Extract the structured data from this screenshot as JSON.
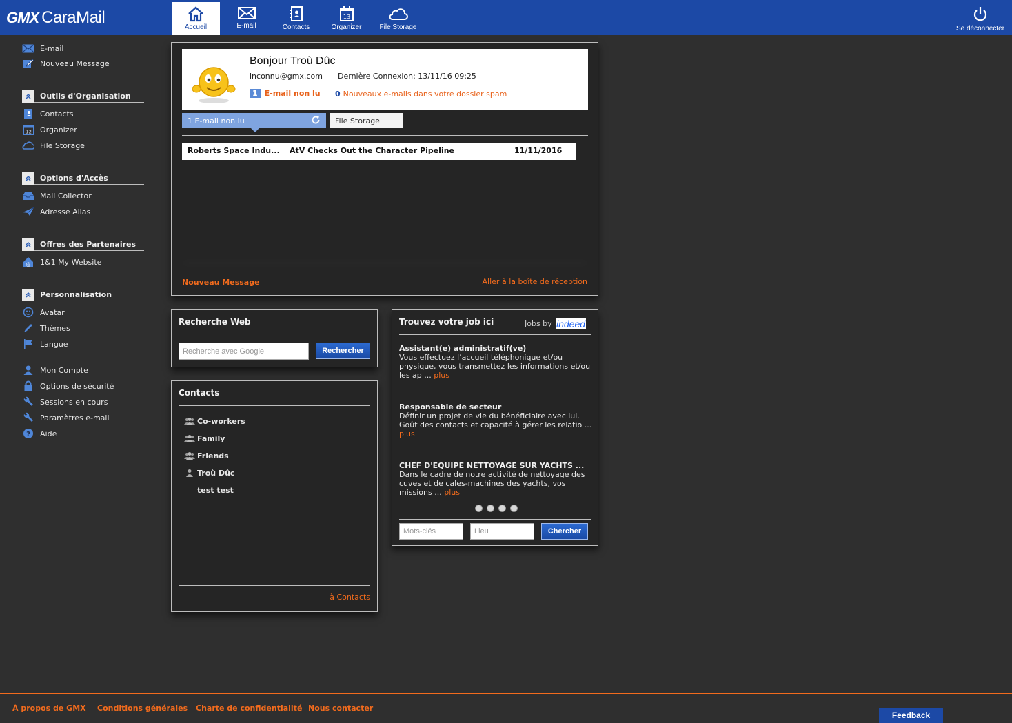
{
  "header": {
    "logo_brand": "GMX",
    "logo_product": "CaraMail",
    "nav": [
      {
        "label": "Accueil",
        "icon": "home-icon",
        "active": true
      },
      {
        "label": "E-mail",
        "icon": "envelope-icon"
      },
      {
        "label": "Contacts",
        "icon": "contacts-book-icon"
      },
      {
        "label": "Organizer",
        "icon": "calendar-icon",
        "day": "13"
      },
      {
        "label": "File Storage",
        "icon": "cloud-icon"
      }
    ],
    "logout_label": "Se déconnecter"
  },
  "sidebar": {
    "top_links": [
      {
        "label": "E-mail",
        "icon": "envelope-icon"
      },
      {
        "label": "Nouveau Message",
        "icon": "pencil-note-icon"
      }
    ],
    "sections": [
      {
        "title": "Outils d'Organisation",
        "items": [
          {
            "label": "Contacts",
            "icon": "contacts-icon"
          },
          {
            "label": "Organizer",
            "icon": "calendar-icon",
            "day": "12"
          },
          {
            "label": "File Storage",
            "icon": "cloud-icon"
          }
        ]
      },
      {
        "title": "Options d'Accès",
        "items": [
          {
            "label": "Mail Collector",
            "icon": "inbox-tray-icon"
          },
          {
            "label": "Adresse Alias",
            "icon": "paper-plane-icon"
          }
        ]
      },
      {
        "title": "Offres des Partenaires",
        "items": [
          {
            "label": "1&1 My Website",
            "icon": "website-house-icon"
          }
        ]
      },
      {
        "title": "Personnalisation",
        "items": [
          {
            "label": "Avatar",
            "icon": "smiley-icon"
          },
          {
            "label": "Thèmes",
            "icon": "brush-icon"
          },
          {
            "label": "Langue",
            "icon": "flag-icon"
          }
        ]
      }
    ],
    "bottom_links": [
      {
        "label": "Mon Compte",
        "icon": "user-icon"
      },
      {
        "label": "Options de sécurité",
        "icon": "lock-icon"
      },
      {
        "label": "Sessions en cours",
        "icon": "wrench-icon"
      },
      {
        "label": "Paramètres e-mail",
        "icon": "wrench-icon"
      },
      {
        "label": "Aide",
        "icon": "help-icon"
      }
    ]
  },
  "welcome": {
    "greeting": "Bonjour Troù Dûc",
    "email": "inconnu@gmx.com",
    "last_login": "Dernière Connexion: 13/11/16 09:25",
    "unread_count": "1",
    "unread_label": "E-mail non lu",
    "spam_count": "0",
    "spam_label": "Nouveaux e-mails dans votre dossier spam",
    "tab_unread": "1 E-mail non lu",
    "tab_storage": "File Storage",
    "messages": [
      {
        "sender": "Roberts Space Indu...",
        "subject": "AtV Checks Out the Character Pipeline",
        "date": "11/11/2016"
      }
    ],
    "new_message_link": "Nouveau Message",
    "inbox_link": "Aller à la boîte de réception"
  },
  "web_search": {
    "title": "Recherche Web",
    "placeholder": "Recherche avec Google",
    "button": "Rechercher"
  },
  "contacts": {
    "title": "Contacts",
    "items": [
      {
        "label": "Co-workers",
        "icon": "group-icon"
      },
      {
        "label": "Family",
        "icon": "group-icon"
      },
      {
        "label": "Friends",
        "icon": "group-icon"
      },
      {
        "label": "Troù Dûc",
        "icon": "person-icon"
      },
      {
        "label": "test test",
        "icon": ""
      }
    ],
    "link": "à Contacts"
  },
  "jobs": {
    "title": "Trouvez votre job ici",
    "by_label": "Jobs by",
    "brand": "indeed",
    "listings": [
      {
        "title": "Assistant(e) administratif(ve)",
        "desc": "Vous effectuez l’accueil téléphonique et/ou physique, vous transmettez les informations et/ou les ap ...",
        "more": "plus"
      },
      {
        "title": "Responsable de secteur",
        "desc": "Définir un projet de vie du bénéficiaire avec lui. Goût des contacts et capacité à gérer les relatio ...",
        "more": "plus"
      },
      {
        "title": "CHEF D'EQUIPE NETTOYAGE SUR YACHTS ...",
        "desc": "Dans le cadre de notre activité de nettoyage des cuves et de cales-machines des yachts, vos missions ...",
        "more": "plus"
      }
    ],
    "keywords_placeholder": "Mots-clés",
    "location_placeholder": "Lieu",
    "button": "Chercher"
  },
  "footer": {
    "links": [
      "À propos de GMX",
      "Conditions générales",
      "Charte de confidentialité",
      "Nous contacter"
    ],
    "feedback": "Feedback"
  },
  "colors": {
    "brand_blue": "#1c49a6",
    "accent_orange": "#f26b1d",
    "background": "#2f2f2f",
    "panel": "#252525"
  }
}
